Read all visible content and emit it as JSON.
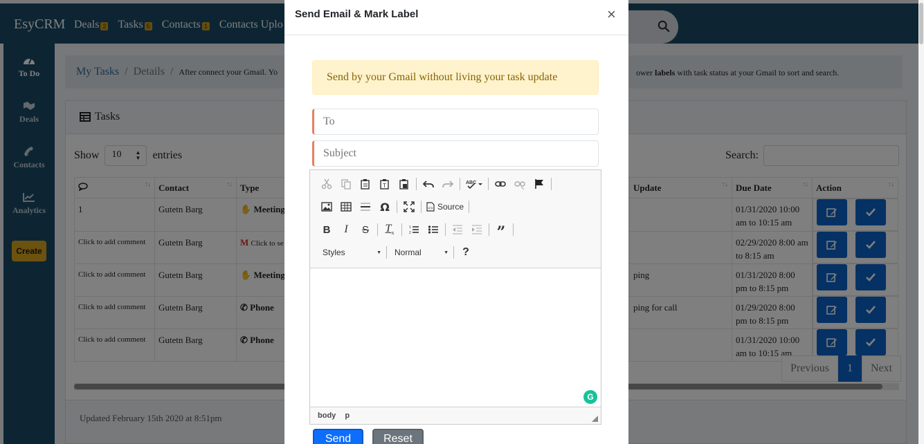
{
  "app": {
    "brand": "EsyCRM",
    "nav": [
      {
        "label": "Deals",
        "badge": "2"
      },
      {
        "label": "Tasks",
        "badge": "5"
      },
      {
        "label": "Contacts",
        "badge": "1"
      },
      {
        "label": "Contacts Uplo",
        "badge": ""
      }
    ]
  },
  "sidebar": {
    "items": [
      {
        "label": "To Do",
        "icon": "dashboard-icon"
      },
      {
        "label": "Deals",
        "icon": "deals-icon"
      },
      {
        "label": "Contacts",
        "icon": "phone-icon"
      },
      {
        "label": "Analytics",
        "icon": "chart-icon"
      }
    ],
    "create_label": "Create"
  },
  "breadcrumb": {
    "my_tasks": "My Tasks",
    "details": "Details",
    "note": "After connect your Gmail. Yo",
    "right_note_pre": "ower ",
    "right_note_bold": "labels",
    "right_note_post": " with task status at your Gmail to sort and search."
  },
  "tasks_card": {
    "title": "Tasks",
    "show_label": "Show",
    "entries_value": "10",
    "entries_label": "entries",
    "search_label": "Search:",
    "columns": [
      "",
      "Contact",
      "Type",
      "Update",
      "Due Date",
      "Action"
    ],
    "rows": [
      {
        "comment": "1",
        "contact": "Gutetn Barg",
        "type": "Meeting",
        "update": "",
        "due": "01/31/2020 10:00 am to 10:15 am"
      },
      {
        "comment": "Click to add comment",
        "contact": "Gutetn Barg",
        "type": "Click to se",
        "update": "",
        "due": "02/29/2020 8:00 am to 8:15 am"
      },
      {
        "comment": "Click to add comment",
        "contact": "Gutetn Barg",
        "type": "Meeting",
        "update": "ping",
        "due": "01/31/2020 8:00 pm to 8:15 pm"
      },
      {
        "comment": "Click to add comment",
        "contact": "Gutetn Barg",
        "type": "Phone",
        "update": "ping for call",
        "due": "01/29/2020 8:00 pm to 8:15 pm"
      },
      {
        "comment": "Click to add comment",
        "contact": "Gutetn Barg",
        "type": "Phone",
        "update": "",
        "due": "01/31/2020 10:00 am to 10:15 am"
      }
    ],
    "pager": {
      "previous": "Previous",
      "current": "1",
      "next": "Next"
    },
    "footer": "Updated February 15th 2020 at 8:51pm"
  },
  "modal": {
    "title": "Send Email & Mark Label",
    "close": "×",
    "alert": "Send by your Gmail without living your task update",
    "to_placeholder": "To",
    "subject_placeholder": "Subject",
    "editor": {
      "source_label": "Source",
      "styles_label": "Styles",
      "format_label": "Normal",
      "help_label": "?",
      "path": [
        "body",
        "p"
      ]
    },
    "send_label": "Send",
    "reset_label": "Reset"
  },
  "colors": {
    "navbar": "#1a4a66",
    "primary": "#0d63c9",
    "create": "#d8a51f",
    "alert_bg": "#fff3cd",
    "field_accent": "#e67f5f"
  }
}
